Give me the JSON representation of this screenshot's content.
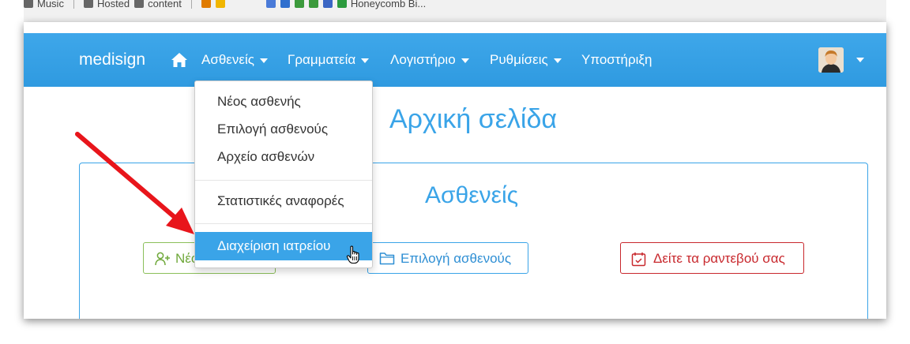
{
  "bookmarks": [
    "Music",
    "Hosted",
    "content",
    "Honeycomb Bi..."
  ],
  "navbar": {
    "brand": "medisign",
    "items": [
      {
        "label": "Ασθενείς",
        "dropdown": true
      },
      {
        "label": "Γραμματεία",
        "dropdown": true
      },
      {
        "label": "Λογιστήριο",
        "dropdown": true
      },
      {
        "label": "Ρυθμίσεις",
        "dropdown": true
      },
      {
        "label": "Υποστήριξη",
        "dropdown": false
      }
    ]
  },
  "dropdown": {
    "items": [
      "Νέος ασθενής",
      "Επιλογή ασθενούς",
      "Αρχείο ασθενών",
      "Στατιστικές αναφορές",
      "Διαχείριση ιατρείου"
    ],
    "active_index": 4
  },
  "page": {
    "title": "Αρχική σελίδα",
    "card_title": "Ασθενείς",
    "buttons": {
      "new_patient_partial": "Νέο",
      "select_patient": "Επιλογή ασθενούς",
      "appointments": "Δείτε τα ραντεβού σας"
    }
  },
  "colors": {
    "navbar": "#3aa4e8",
    "accent": "#3aa4e8",
    "green": "#6fa83a",
    "red": "#c8282d",
    "annotation_arrow": "#e8151b"
  },
  "icons": [
    "home-icon",
    "user-avatar",
    "add-user-icon",
    "folder-icon",
    "calendar-check-icon",
    "hand-pointer-icon"
  ]
}
